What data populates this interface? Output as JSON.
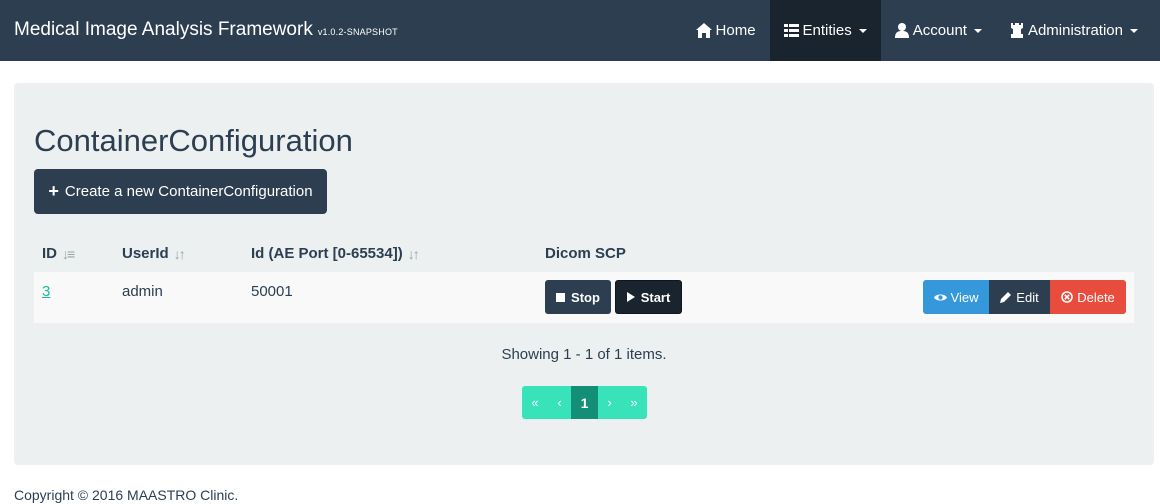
{
  "navbar": {
    "brand": "Medical Image Analysis Framework",
    "version": "v1.0.2-SNAPSHOT",
    "items": [
      {
        "label": "Home",
        "icon": "home-icon"
      },
      {
        "label": "Entities",
        "icon": "list-icon",
        "active": true,
        "dropdown": true
      },
      {
        "label": "Account",
        "icon": "user-icon",
        "dropdown": true
      },
      {
        "label": "Administration",
        "icon": "tower-icon",
        "dropdown": true
      }
    ]
  },
  "page": {
    "title": "ContainerConfiguration",
    "create_label": "Create a new ContainerConfiguration"
  },
  "table": {
    "headers": {
      "id": "ID",
      "userid": "UserId",
      "port": "Id (AE Port [0-65534])",
      "dicom": "Dicom SCP"
    },
    "rows": [
      {
        "id": "3",
        "userid": "admin",
        "port": "50001"
      }
    ],
    "row_actions": {
      "stop": "Stop",
      "start": "Start",
      "view": "View",
      "edit": "Edit",
      "delete": "Delete"
    }
  },
  "pagination": {
    "summary": "Showing 1 - 1 of 1 items.",
    "first": "«",
    "prev": "‹",
    "current": "1",
    "next": "›",
    "last": "»"
  },
  "footer": {
    "text": "Copyright © 2016 MAASTRO Clinic."
  },
  "colors": {
    "navbar": "#2c3e50",
    "panel": "#ecf0f1",
    "accent": "#18bc9c",
    "info": "#3498db",
    "danger": "#e74c3c"
  }
}
